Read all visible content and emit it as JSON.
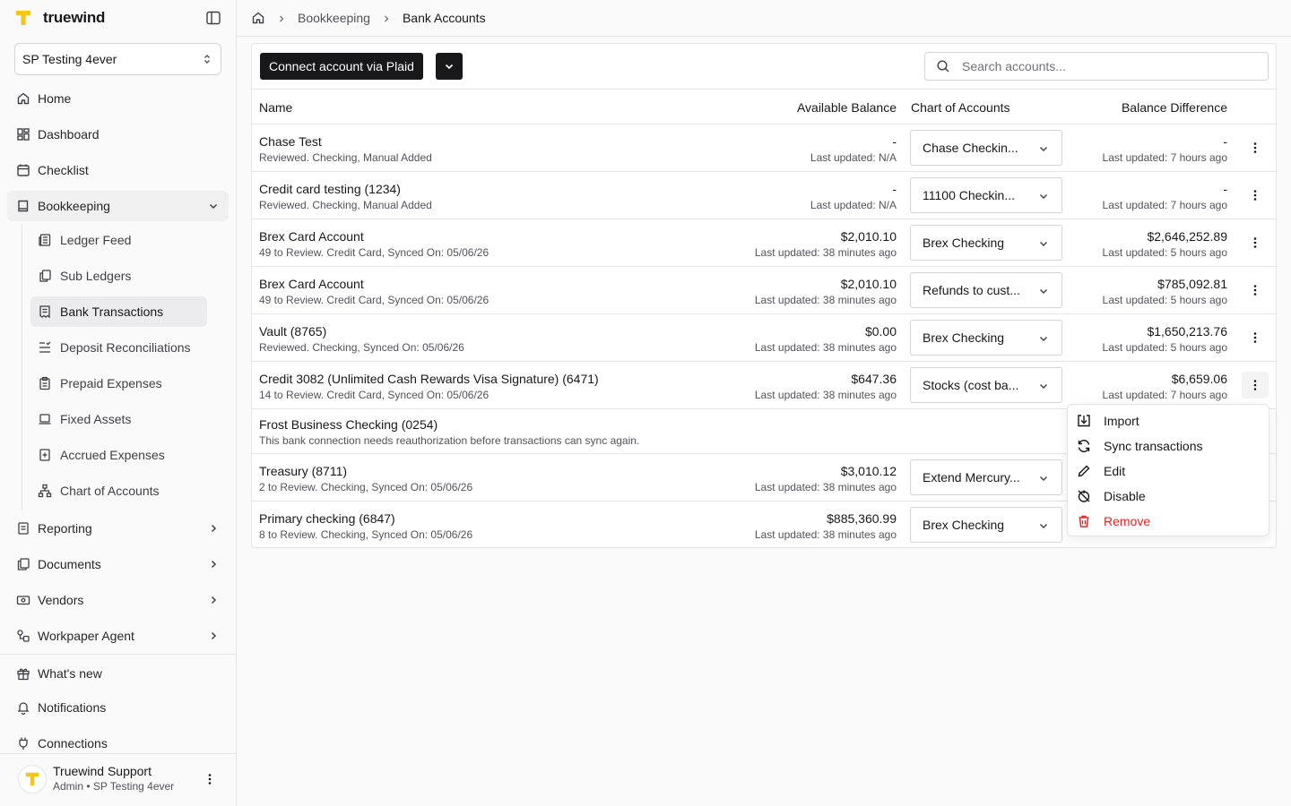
{
  "brand": {
    "name": "truewind"
  },
  "org": {
    "selected": "SP Testing 4ever"
  },
  "nav": {
    "home": "Home",
    "dashboard": "Dashboard",
    "checklist": "Checklist",
    "bookkeeping": "Bookkeeping",
    "sub": {
      "ledger_feed": "Ledger Feed",
      "sub_ledgers": "Sub Ledgers",
      "bank_transactions": "Bank Transactions",
      "deposit_reconciliations": "Deposit Reconciliations",
      "prepaid_expenses": "Prepaid Expenses",
      "fixed_assets": "Fixed Assets",
      "accrued_expenses": "Accrued Expenses",
      "chart_of_accounts": "Chart of Accounts"
    },
    "reporting": "Reporting",
    "documents": "Documents",
    "vendors": "Vendors",
    "workpaper_agent": "Workpaper Agent",
    "whats_new": "What's new",
    "notifications": "Notifications",
    "connections": "Connections"
  },
  "user": {
    "name": "Truewind Support",
    "role": "Admin • SP Testing 4ever"
  },
  "breadcrumb": {
    "section": "Bookkeeping",
    "current": "Bank Accounts"
  },
  "toolbar": {
    "connect_label": "Connect account via Plaid",
    "search_placeholder": "Search accounts..."
  },
  "table": {
    "headers": {
      "name": "Name",
      "available_balance": "Available Balance",
      "chart_of_accounts": "Chart of Accounts",
      "balance_difference": "Balance Difference"
    },
    "rows": [
      {
        "name": "Chase Test",
        "sub": "Reviewed. Checking, Manual Added",
        "balance": "-",
        "balance_updated": "Last updated: N/A",
        "coa": "Chase Checkin...",
        "diff": "-",
        "diff_updated": "Last updated: 7 hours ago"
      },
      {
        "name": "Credit card testing (1234)",
        "sub": "Reviewed. Checking, Manual Added",
        "balance": "-",
        "balance_updated": "Last updated: N/A",
        "coa": "11100 Checkin...",
        "diff": "-",
        "diff_updated": "Last updated: 7 hours ago"
      },
      {
        "name": "Brex Card Account",
        "sub": "49 to Review. Credit Card, Synced On: 05/06/26",
        "balance": "$2,010.10",
        "balance_updated": "Last updated: 38 minutes ago",
        "coa": "Brex Checking",
        "diff": "$2,646,252.89",
        "diff_updated": "Last updated: 5 hours ago"
      },
      {
        "name": "Brex Card Account",
        "sub": "49 to Review. Credit Card, Synced On: 05/06/26",
        "balance": "$2,010.10",
        "balance_updated": "Last updated: 38 minutes ago",
        "coa": "Refunds to cust...",
        "diff": "$785,092.81",
        "diff_updated": "Last updated: 5 hours ago"
      },
      {
        "name": "Vault (8765)",
        "sub": "Reviewed. Checking, Synced On: 05/06/26",
        "balance": "$0.00",
        "balance_updated": "Last updated: 38 minutes ago",
        "coa": "Brex Checking",
        "diff": "$1,650,213.76",
        "diff_updated": "Last updated: 5 hours ago"
      },
      {
        "name": "Credit 3082 (Unlimited Cash Rewards Visa Signature) (6471)",
        "sub": "14 to Review. Credit Card, Synced On: 05/06/26",
        "balance": "$647.36",
        "balance_updated": "Last updated: 38 minutes ago",
        "coa": "Stocks (cost ba...",
        "diff": "$6,659.06",
        "diff_updated": "Last updated: 7 hours ago"
      },
      {
        "name": "Frost Business Checking (0254)",
        "sub": "This bank connection needs reauthorization before transactions can sync again."
      },
      {
        "name": "Treasury (8711)",
        "sub": "2 to Review. Checking, Synced On: 05/06/26",
        "balance": "$3,010.12",
        "balance_updated": "Last updated: 38 minutes ago",
        "coa": "Extend Mercury..."
      },
      {
        "name": "Primary checking (6847)",
        "sub": "8 to Review. Checking, Synced On: 05/06/26",
        "balance": "$885,360.99",
        "balance_updated": "Last updated: 38 minutes ago",
        "coa": "Brex Checking"
      }
    ]
  },
  "row_menu": {
    "import": "Import",
    "sync": "Sync transactions",
    "edit": "Edit",
    "disable": "Disable",
    "remove": "Remove"
  },
  "colors": {
    "brand_yellow": "#f5c518",
    "danger": "#dc2626",
    "primary": "#18181b"
  }
}
